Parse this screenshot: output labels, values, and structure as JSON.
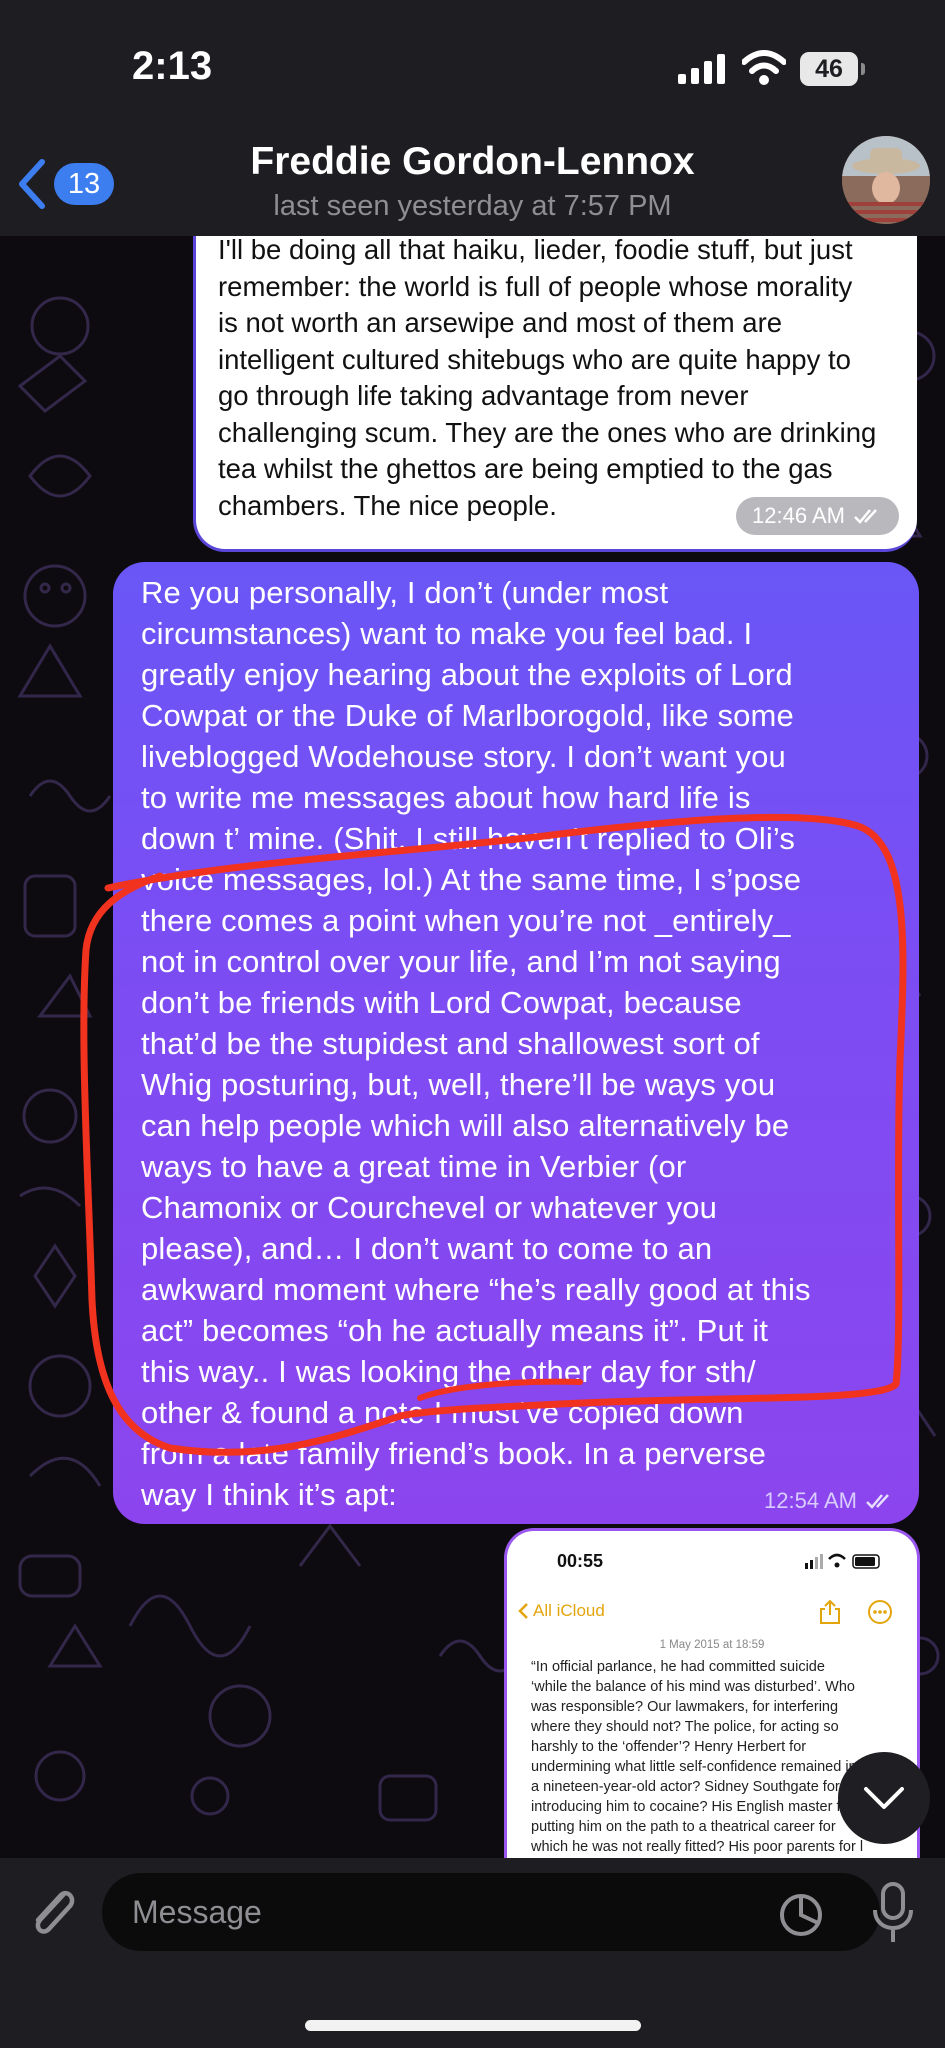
{
  "status_bar": {
    "time": "2:13",
    "battery": "46"
  },
  "header": {
    "back_badge": "13",
    "title": "Freddie Gordon-Lennox",
    "subtitle": "last seen yesterday at 7:57 PM"
  },
  "messages": [
    {
      "direction": "incoming",
      "text": "I'll be doing all that haiku, lieder, foodie stuff, but just\nremember: the world is full of people whose morality\nis not worth an arsewipe and most of them are\nintelligent cultured shitebugs who are quite happy to\ngo through life taking advantage from never\nchallenging scum. They are the ones who are drinking\ntea whilst the ghettos are being emptied to the gas\nchambers. The nice people.",
      "time": "12:46 AM"
    },
    {
      "direction": "outgoing",
      "text": "Re you personally, I don’t (under most\ncircumstances) want to make you feel bad. I\ngreatly enjoy hearing about the exploits of Lord\nCowpat or the Duke of Marlborogold, like some\nliveblogged Wodehouse story. I don’t want you\nto write me messages about how hard life is\ndown t’ mine. (Shit, I still haven’t replied to Oli’s\nvoice messages, lol.) At the same time, I s’pose\nthere comes a point when you’re not _entirely_\nnot in control over your life, and I’m not saying\ndon’t be friends with Lord Cowpat, because\nthat’d be the stupidest and shallowest sort of\nWhig posturing, but, well, there’ll be ways you\ncan help people which will also alternatively be\nways to have a great time in Verbier (or\nChamonix or Courchevel or whatever you\nplease), and… I don’t want to come to an\nawkward moment where “he’s really good at this\nact” becomes “oh he actually means it”. Put it\nthis way.. I was looking the other day for sth/\nother & found a note I must’ve copied down\nfrom a late family friend’s book. In a perverse\nway I think it’s apt:",
      "time": "12:54 AM"
    },
    {
      "direction": "outgoing",
      "type": "image",
      "screenshot": {
        "time": "00:55",
        "back_label": "All iCloud",
        "date": "1 May 2015 at 18:59",
        "body": "“In official parlance, he had committed suicide\n‘while the balance of his mind was disturbed’. Who\nwas responsible? Our lawmakers, for interfering\nwhere they should not? The police, for acting so\nharshly to the ‘offender’? Henry Herbert for\nundermining what little self-confidence remained in\na nineteen-year-old actor? Sidney Southgate for\nintroducing him to cocaine? His English master for\nputting him on the path to a theatrical career for\nwhich he was not really fitted? His poor parents for l"
      }
    }
  ],
  "composer": {
    "placeholder": "Message"
  },
  "colors": {
    "outgoing_bubble": "#7d4cf3",
    "accent": "#3c7df0",
    "annotation": "#f0321e"
  }
}
